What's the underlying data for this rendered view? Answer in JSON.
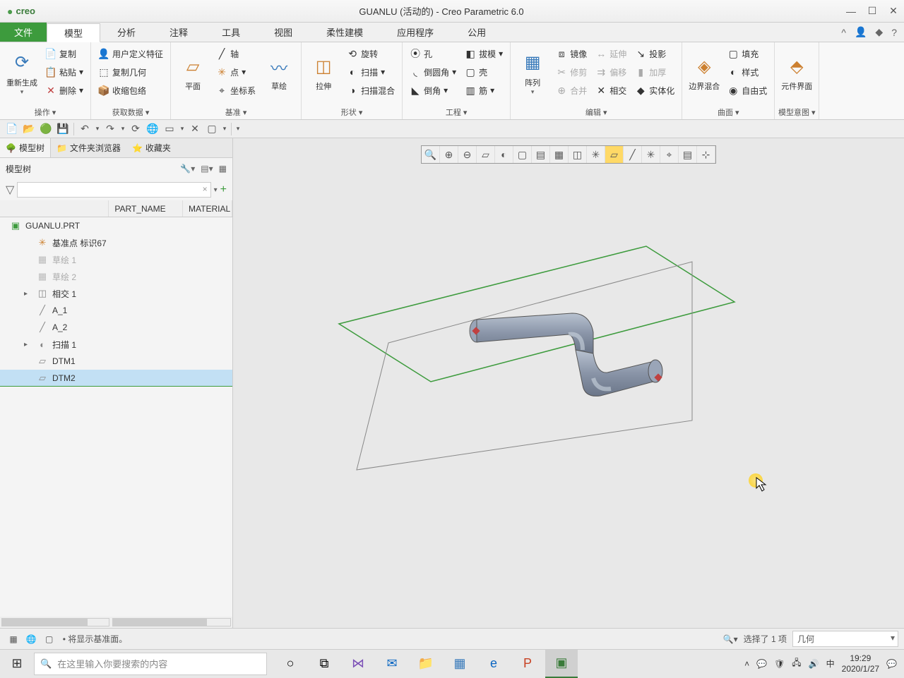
{
  "window": {
    "logo": "creo",
    "title": "GUANLU (活动的) - Creo Parametric 6.0"
  },
  "ribbon_tabs": {
    "file": "文件",
    "items": [
      "模型",
      "分析",
      "注释",
      "工具",
      "视图",
      "柔性建模",
      "应用程序",
      "公用"
    ],
    "active": 0
  },
  "ribbon": {
    "group_ops": {
      "label": "操作 ▾",
      "regen": "重新生成",
      "copy": "复制",
      "paste": "粘贴",
      "delete": "删除"
    },
    "group_getdata": {
      "label": "获取数据 ▾",
      "udf": "用户定义特征",
      "copygeom": "复制几何",
      "shrink": "收缩包络"
    },
    "group_datum": {
      "label": "基准 ▾",
      "plane": "平面",
      "sketch": "草绘",
      "axis": "轴",
      "point": "点",
      "csys": "坐标系"
    },
    "group_shape": {
      "label": "形状 ▾",
      "extrude": "拉伸",
      "revolve": "旋转",
      "sweep": "扫描",
      "swblend": "扫描混合"
    },
    "group_eng": {
      "label": "工程 ▾",
      "hole": "孔",
      "round": "倒圆角",
      "chamfer": "倒角",
      "draft": "拔模",
      "shell": "壳",
      "rib": "筋"
    },
    "group_edit": {
      "label": "编辑 ▾",
      "pattern": "阵列",
      "mirror": "镜像",
      "trim": "修剪",
      "merge": "合并",
      "extend": "延伸",
      "offset": "偏移",
      "intersect": "相交",
      "thick": "加厚",
      "project": "投影",
      "solidify": "实体化"
    },
    "group_surf": {
      "label": "曲面 ▾",
      "boundary": "边界混合",
      "fill": "填充",
      "style": "样式",
      "freestyle": "自由式"
    },
    "group_view": {
      "label": "模型意图 ▾",
      "partif": "元件界面"
    }
  },
  "left_panel": {
    "tabs": [
      "模型树",
      "文件夹浏览器",
      "收藏夹"
    ],
    "header": "模型树",
    "cols": {
      "c1": "",
      "c2": "PART_NAME",
      "c3": "MATERIAL"
    },
    "tree": {
      "root": "GUANLU.PRT",
      "items": [
        {
          "label": "基准点 标识67",
          "icon": "✳",
          "iconcolor": "#cc8030"
        },
        {
          "label": "草绘 1",
          "icon": "▦",
          "dim": true
        },
        {
          "label": "草绘 2",
          "icon": "▦",
          "dim": true
        },
        {
          "label": "相交 1",
          "icon": "◫",
          "expand": "▸"
        },
        {
          "label": "A_1",
          "icon": "╱"
        },
        {
          "label": "A_2",
          "icon": "╱"
        },
        {
          "label": "扫描 1",
          "icon": "◐",
          "expand": "▸"
        },
        {
          "label": "DTM1",
          "icon": "▱"
        },
        {
          "label": "DTM2",
          "icon": "▱",
          "selected": true
        }
      ]
    }
  },
  "status": {
    "msg": "• 将显示基准面。",
    "selection": "选择了 1 项",
    "filter": "几何"
  },
  "taskbar": {
    "search_placeholder": "在这里输入你要搜索的内容",
    "time": "19:29",
    "date": "2020/1/27",
    "ime": "中"
  }
}
